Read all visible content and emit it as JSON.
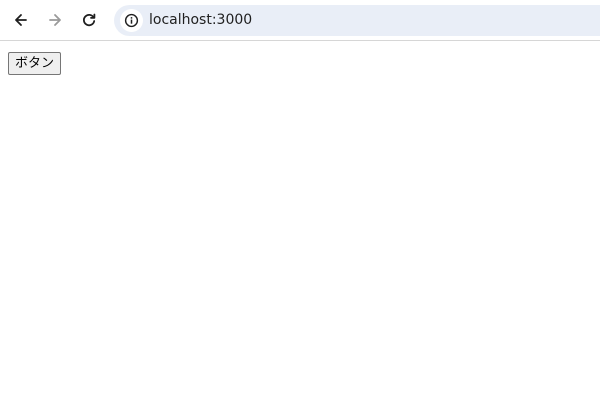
{
  "browser": {
    "url": "localhost:3000",
    "back_icon": "arrow-left-icon",
    "forward_icon": "arrow-right-icon",
    "reload_icon": "reload-icon",
    "site_info_icon": "info-icon",
    "address_bar_color": "#e9eef7"
  },
  "page": {
    "button_label": "ボタン"
  }
}
